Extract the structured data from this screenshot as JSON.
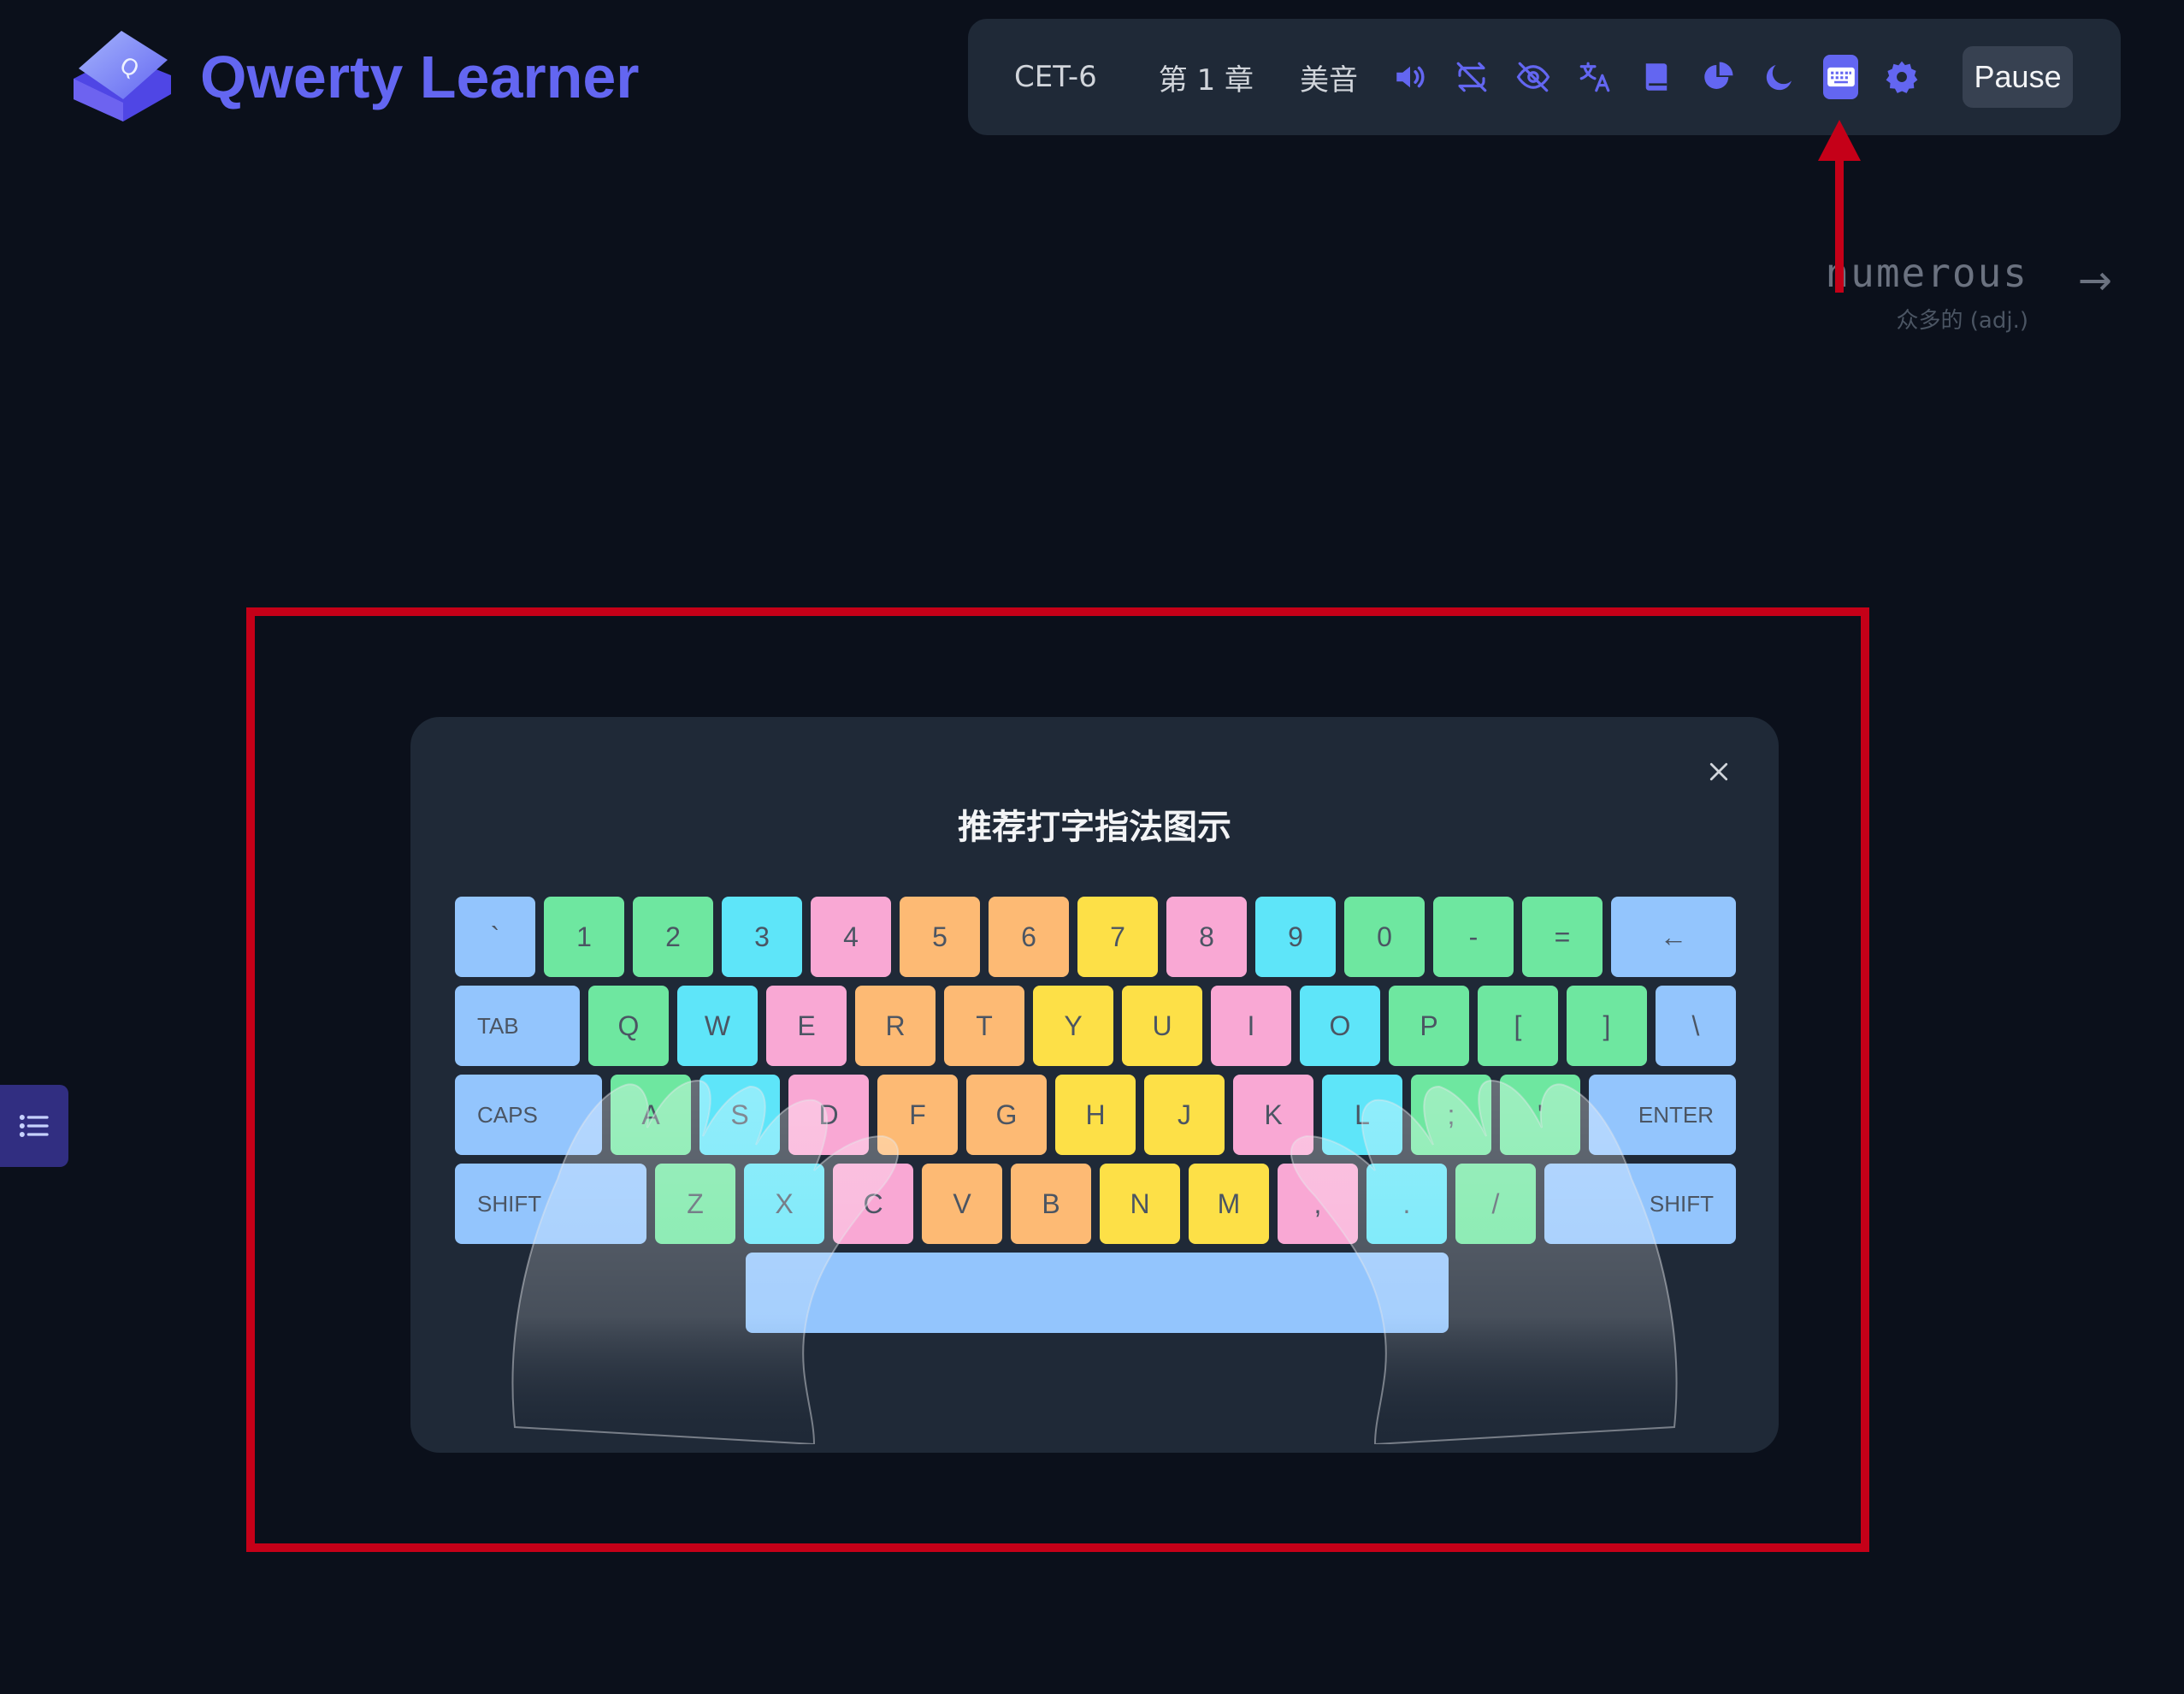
{
  "app": {
    "title": "Qwerty Learner"
  },
  "toolbar": {
    "dictionary": "CET-6",
    "chapter": "第 1 章",
    "pronunciation": "美音",
    "icons": [
      "speaker-icon",
      "loop-icon",
      "eye-off-icon",
      "translate-icon",
      "book-icon",
      "pie-chart-icon",
      "moon-icon",
      "keyboard-icon",
      "gear-icon"
    ],
    "pause_label": "Pause",
    "accent_color": "#6366f1"
  },
  "word": {
    "text": "numerous",
    "translation": "众多的 (adj.)",
    "next_arrow": "→"
  },
  "modal": {
    "title": "推荐打字指法图示",
    "close_icon": "close-icon",
    "keyboard_rows": [
      [
        {
          "label": "`",
          "color": "blue"
        },
        {
          "label": "1",
          "color": "green"
        },
        {
          "label": "2",
          "color": "green"
        },
        {
          "label": "3",
          "color": "cyan"
        },
        {
          "label": "4",
          "color": "pink"
        },
        {
          "label": "5",
          "color": "orange"
        },
        {
          "label": "6",
          "color": "orange"
        },
        {
          "label": "7",
          "color": "yellow"
        },
        {
          "label": "8",
          "color": "pink"
        },
        {
          "label": "9",
          "color": "cyan"
        },
        {
          "label": "0",
          "color": "green"
        },
        {
          "label": "-",
          "color": "green"
        },
        {
          "label": "=",
          "color": "green"
        },
        {
          "label": "←",
          "color": "blue"
        }
      ],
      [
        {
          "label": "TAB",
          "color": "blue"
        },
        {
          "label": "Q",
          "color": "green"
        },
        {
          "label": "W",
          "color": "cyan"
        },
        {
          "label": "E",
          "color": "pink"
        },
        {
          "label": "R",
          "color": "orange"
        },
        {
          "label": "T",
          "color": "orange"
        },
        {
          "label": "Y",
          "color": "yellow"
        },
        {
          "label": "U",
          "color": "yellow"
        },
        {
          "label": "I",
          "color": "pink"
        },
        {
          "label": "O",
          "color": "cyan"
        },
        {
          "label": "P",
          "color": "green"
        },
        {
          "label": "[",
          "color": "green"
        },
        {
          "label": "]",
          "color": "green"
        },
        {
          "label": "\\",
          "color": "blue"
        }
      ],
      [
        {
          "label": "CAPS",
          "color": "blue"
        },
        {
          "label": "A",
          "color": "green"
        },
        {
          "label": "S",
          "color": "cyan"
        },
        {
          "label": "D",
          "color": "pink"
        },
        {
          "label": "F",
          "color": "orange"
        },
        {
          "label": "G",
          "color": "orange"
        },
        {
          "label": "H",
          "color": "yellow"
        },
        {
          "label": "J",
          "color": "yellow"
        },
        {
          "label": "K",
          "color": "pink"
        },
        {
          "label": "L",
          "color": "cyan"
        },
        {
          "label": ";",
          "color": "green"
        },
        {
          "label": "'",
          "color": "green"
        },
        {
          "label": "ENTER",
          "color": "blue"
        }
      ],
      [
        {
          "label": "SHIFT",
          "color": "blue"
        },
        {
          "label": "Z",
          "color": "green"
        },
        {
          "label": "X",
          "color": "cyan"
        },
        {
          "label": "C",
          "color": "pink"
        },
        {
          "label": "V",
          "color": "orange"
        },
        {
          "label": "B",
          "color": "orange"
        },
        {
          "label": "N",
          "color": "yellow"
        },
        {
          "label": "M",
          "color": "yellow"
        },
        {
          "label": ",",
          "color": "pink"
        },
        {
          "label": ".",
          "color": "cyan"
        },
        {
          "label": "/",
          "color": "green"
        },
        {
          "label": "SHIFT",
          "color": "blue"
        }
      ],
      [
        {
          "label": "",
          "color": "blue"
        }
      ]
    ]
  },
  "annotation_color": "#c50018"
}
